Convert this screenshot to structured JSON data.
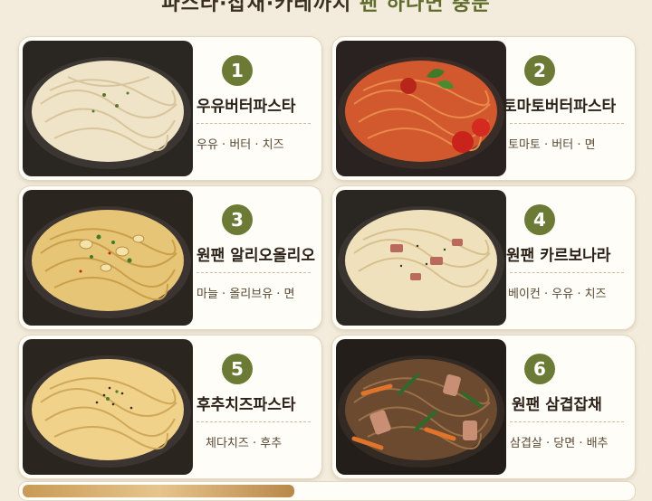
{
  "header": {
    "title_part1": "파스타·잡채·카레까지 ",
    "title_highlight": "팬 하나면 충분"
  },
  "recipes": [
    {
      "number": "1",
      "title": "우유버터파스타",
      "ingredients": "우유 · 버터 · 치즈",
      "photo_icon": "creamy-pasta-photo"
    },
    {
      "number": "2",
      "title": "토마토버터파스타",
      "ingredients": "토마토 · 버터 · 면",
      "photo_icon": "tomato-pasta-photo"
    },
    {
      "number": "3",
      "title": "원팬 알리오올리오",
      "ingredients": "마늘 · 올리브유 · 면",
      "photo_icon": "aglio-olio-photo"
    },
    {
      "number": "4",
      "title": "원팬 카르보나라",
      "ingredients": "베이컨 · 우유 · 치즈",
      "photo_icon": "carbonara-photo"
    },
    {
      "number": "5",
      "title": "후추치즈파스타",
      "ingredients": "체다치즈 · 후추",
      "photo_icon": "pepper-cheese-pasta-photo"
    },
    {
      "number": "6",
      "title": "원팬 삼겹잡채",
      "ingredients": "삼겹살 · 당면 · 배추",
      "photo_icon": "pork-japchae-photo"
    }
  ],
  "colors": {
    "accent": "#6b7a34",
    "background": "#f3ecdc",
    "card": "#fffdf7"
  }
}
